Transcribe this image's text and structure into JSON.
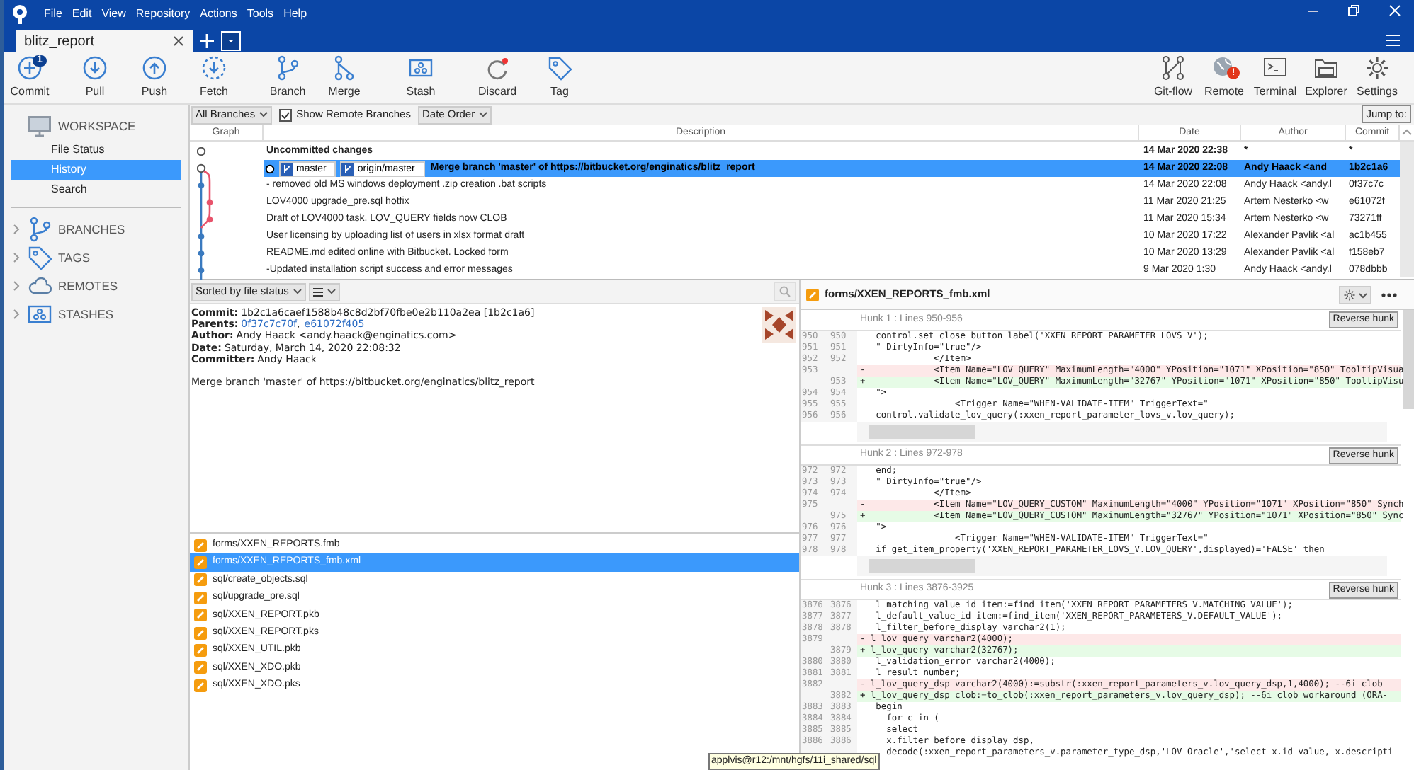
{
  "menu": [
    "File",
    "Edit",
    "View",
    "Repository",
    "Actions",
    "Tools",
    "Help"
  ],
  "tabs": [
    {
      "label": "blitz_report",
      "selected": true
    }
  ],
  "toolbar_left": [
    {
      "label": "Commit",
      "kind": "plus",
      "badge": "1"
    },
    {
      "label": "Pull",
      "kind": "down"
    },
    {
      "label": "Push",
      "kind": "up"
    },
    {
      "label": "Fetch",
      "kind": "fetch"
    },
    {
      "label": "Branch",
      "kind": "branch"
    },
    {
      "label": "Merge",
      "kind": "merge"
    },
    {
      "label": "Stash",
      "kind": "stash"
    },
    {
      "label": "Discard",
      "kind": "discard"
    },
    {
      "label": "Tag",
      "kind": "tag"
    }
  ],
  "toolbar_right": [
    {
      "label": "Git-flow",
      "kind": "gitflow"
    },
    {
      "label": "Remote",
      "kind": "globe",
      "alert": "!"
    },
    {
      "label": "Terminal",
      "kind": "terminal"
    },
    {
      "label": "Explorer",
      "kind": "folder"
    },
    {
      "label": "Settings",
      "kind": "gear"
    }
  ],
  "sidebar": [
    {
      "label": "WORKSPACE",
      "kind": "monitor",
      "expanded": true,
      "items": [
        {
          "label": "File Status",
          "selected": false
        },
        {
          "label": "History",
          "selected": true
        },
        {
          "label": "Search",
          "selected": false
        }
      ]
    },
    {
      "label": "BRANCHES",
      "kind": "branch",
      "expanded": false
    },
    {
      "label": "TAGS",
      "kind": "tag",
      "expanded": false
    },
    {
      "label": "REMOTES",
      "kind": "cloud",
      "expanded": false
    },
    {
      "label": "STASHES",
      "kind": "stash",
      "expanded": false
    }
  ],
  "filter": {
    "branches": "All Branches",
    "show_remote": {
      "label": "Show Remote Branches",
      "checked": true
    },
    "order": "Date Order",
    "jump": "Jump to:"
  },
  "table": {
    "columns": [
      "Graph",
      "Description",
      "Date",
      "Author",
      "Commit"
    ],
    "rows": [
      {
        "description": "Uncommitted changes",
        "date": "14 Mar 2020 22:38",
        "author": "*",
        "commit": "*",
        "selected": false,
        "bold": true
      },
      {
        "labels": [
          "master",
          "origin/master"
        ],
        "description": "Merge branch 'master' of https://bitbucket.org/enginatics/blitz_report",
        "date": "14 Mar 2020 22:08",
        "author": "Andy Haack <and",
        "commit": "1b2c1a6",
        "selected": true,
        "bold": true
      },
      {
        "description": "- removed old MS windows deployment .zip creation .bat scripts",
        "date": "14 Mar 2020 22:08",
        "author": "Andy Haack <andy.l",
        "commit": "0f37c7c",
        "selected": false,
        "bold": false
      },
      {
        "description": "LOV4000 upgrade_pre.sql hotfix",
        "date": "11 Mar 2020 21:25",
        "author": "Artem Nesterko <w",
        "commit": "e61072f",
        "selected": false,
        "bold": false
      },
      {
        "description": "Draft of LOV4000 task. LOV_QUERY fields now CLOB",
        "date": "11 Mar 2020 15:34",
        "author": "Artem Nesterko <w",
        "commit": "73271ff",
        "selected": false,
        "bold": false
      },
      {
        "description": "User licensing by uploading list of users in xlsx format draft",
        "date": "10 Mar 2020 17:22",
        "author": "Alexander Pavlik <al",
        "commit": "ac1b455",
        "selected": false,
        "bold": false
      },
      {
        "description": "README.md edited online with Bitbucket. Locked form",
        "date": "10 Mar 2020 13:29",
        "author": "Alexander Pavlik <al",
        "commit": "f158eb7",
        "selected": false,
        "bold": false
      },
      {
        "description": "-Updated installation script success and error messages",
        "date": "9 Mar 2020 1:30",
        "author": "Andy Haack <andy.l",
        "commit": "078dbbb",
        "selected": false,
        "bold": false
      }
    ]
  },
  "file_sort": "Sorted by file status",
  "details": [
    {
      "key": "Commit:",
      "value": "1b2c1a6caef1588b48c8d2bf70fbe0e2b110a2ea [1b2c1a6]"
    },
    {
      "key": "Parents:",
      "links": [
        "0f37c7c70f",
        "e61072f405"
      ],
      "separator": ","
    },
    {
      "key": "Author:",
      "value": "Andy Haack <andy.haack@enginatics.com>"
    },
    {
      "key": "Date:",
      "value": "Saturday, March 14, 2020 22:08:32"
    },
    {
      "key": "Committer:",
      "value": "Andy Haack"
    }
  ],
  "message": "Merge branch 'master' of https://bitbucket.org/enginatics/blitz_report",
  "files": [
    {
      "path": "forms/XXEN_REPORTS.fmb",
      "selected": false
    },
    {
      "path": "forms/XXEN_REPORTS_fmb.xml",
      "selected": true
    },
    {
      "path": "sql/create_objects.sql",
      "selected": false
    },
    {
      "path": "sql/upgrade_pre.sql",
      "selected": false
    },
    {
      "path": "sql/XXEN_REPORT.pkb",
      "selected": false
    },
    {
      "path": "sql/XXEN_REPORT.pks",
      "selected": false
    },
    {
      "path": "sql/XXEN_UTIL.pkb",
      "selected": false
    },
    {
      "path": "sql/XXEN_XDO.pkb",
      "selected": false
    },
    {
      "path": "sql/XXEN_XDO.pks",
      "selected": false
    }
  ],
  "diff": {
    "file": "forms/XXEN_REPORTS_fmb.xml",
    "hunks": [
      {
        "title": "Hunk 1 : Lines 950-956",
        "button": "Reverse hunk",
        "lines": [
          {
            "kind": "context",
            "old": "950",
            "new": "950",
            "text": "   control.set_close_button_label('XXEN_REPORT_PARAMETER_LOVS_V');"
          },
          {
            "kind": "context",
            "old": "951",
            "new": "951",
            "text": "   \" DirtyInfo=\"true\"/>"
          },
          {
            "kind": "context",
            "old": "952",
            "new": "952",
            "text": "              </Item>"
          },
          {
            "kind": "removed",
            "old": "953",
            "text": "-             <Item Name=\"LOV_QUERY\" MaximumLength=\"4000\" YPosition=\"1071\" XPosition=\"850\" TooltipVisua"
          },
          {
            "kind": "added",
            "new": "953",
            "text": "+             <Item Name=\"LOV_QUERY\" MaximumLength=\"32767\" YPosition=\"1071\" XPosition=\"850\" TooltipVisu"
          },
          {
            "kind": "context",
            "old": "954",
            "new": "954",
            "text": "   \">"
          },
          {
            "kind": "context",
            "old": "955",
            "new": "955",
            "text": "                  <Trigger Name=\"WHEN-VALIDATE-ITEM\" TriggerText=\""
          },
          {
            "kind": "context",
            "old": "956",
            "new": "956",
            "text": "   control.validate_lov_query(:xxen_report_parameter_lovs_v.lov_query);"
          }
        ]
      },
      {
        "title": "Hunk 2 : Lines 972-978",
        "button": "Reverse hunk",
        "lines": [
          {
            "kind": "context",
            "old": "972",
            "new": "972",
            "text": "   end;"
          },
          {
            "kind": "context",
            "old": "973",
            "new": "973",
            "text": "   \" DirtyInfo=\"true\"/>"
          },
          {
            "kind": "context",
            "old": "974",
            "new": "974",
            "text": "              </Item>"
          },
          {
            "kind": "removed",
            "old": "975",
            "text": "-             <Item Name=\"LOV_QUERY_CUSTOM\" MaximumLength=\"4000\" YPosition=\"1071\" XPosition=\"850\" Synch"
          },
          {
            "kind": "added",
            "new": "975",
            "text": "+             <Item Name=\"LOV_QUERY_CUSTOM\" MaximumLength=\"32767\" YPosition=\"1071\" XPosition=\"850\" Sync"
          },
          {
            "kind": "context",
            "old": "976",
            "new": "976",
            "text": "   \">"
          },
          {
            "kind": "context",
            "old": "977",
            "new": "977",
            "text": "                  <Trigger Name=\"WHEN-VALIDATE-ITEM\" TriggerText=\""
          },
          {
            "kind": "context",
            "old": "978",
            "new": "978",
            "text": "   if get_item_property('XXEN_REPORT_PARAMETER_LOVS_V.LOV_QUERY',displayed)='FALSE' then"
          }
        ]
      },
      {
        "title": "Hunk 3 : Lines 3876-3925",
        "button": "Reverse hunk",
        "lines": [
          {
            "kind": "context",
            "old": "3876",
            "new": "3876",
            "text": "   l_matching_value_id item:=find_item('XXEN_REPORT_PARAMETERS_V.MATCHING_VALUE');"
          },
          {
            "kind": "context",
            "old": "3877",
            "new": "3877",
            "text": "   l_default_value_id item:=find_item('XXEN_REPORT_PARAMETERS_V.DEFAULT_VALUE');"
          },
          {
            "kind": "context",
            "old": "3878",
            "new": "3878",
            "text": "   l_filter_before_display varchar2(1);"
          },
          {
            "kind": "removed",
            "old": "3879",
            "text": "- l_lov_query varchar2(4000);"
          },
          {
            "kind": "added",
            "new": "3879",
            "text": "+ l_lov_query varchar2(32767);"
          },
          {
            "kind": "context",
            "old": "3880",
            "new": "3880",
            "text": "   l_validation_error varchar2(4000);"
          },
          {
            "kind": "context",
            "old": "3881",
            "new": "3881",
            "text": "   l_result number;"
          },
          {
            "kind": "removed",
            "old": "3882",
            "text": "- l_lov_query_dsp varchar2(4000):=substr(:xxen_report_parameters_v.lov_query_dsp,1,4000); --6i clob"
          },
          {
            "kind": "added",
            "new": "3882",
            "text": "+ l_lov_query_dsp clob:=to_clob(:xxen_report_parameters_v.lov_query_dsp); --6i clob workaround (ORA-"
          },
          {
            "kind": "context",
            "old": "3883",
            "new": "3883",
            "text": "   begin"
          },
          {
            "kind": "context",
            "old": "3884",
            "new": "3884",
            "text": "     for c in ("
          },
          {
            "kind": "context",
            "old": "3885",
            "new": "3885",
            "text": "     select"
          },
          {
            "kind": "context",
            "old": "3886",
            "new": "3886",
            "text": "     x.filter_before_display_dsp,"
          },
          {
            "kind": "context",
            "text": "     decode(:xxen_report_parameters_v.parameter_type_dsp,'LOV Oracle','select x.id value, x.descripti"
          }
        ]
      }
    ]
  },
  "tooltip": "applvis@r12:/mnt/hgfs/11i_shared/sql"
}
